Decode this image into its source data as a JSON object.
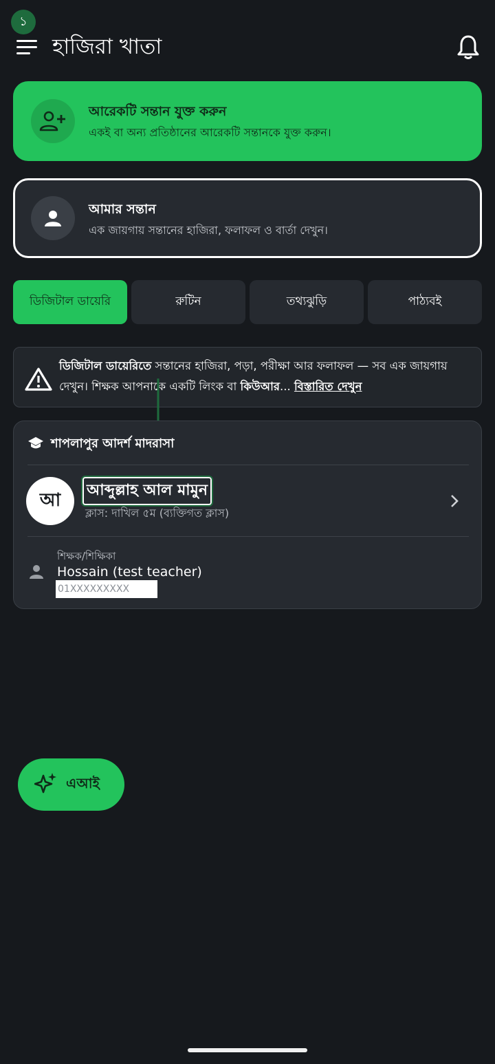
{
  "status": {
    "step_badge": "১"
  },
  "header": {
    "title": "হাজিরা খাতা",
    "menu_icon": "hamburger-icon",
    "notification_icon": "bell-icon"
  },
  "add_child_card": {
    "title": "আরেকটি সন্তান যুক্ত করুন",
    "subtitle": "একই বা অন্য প্রতিষ্ঠানের আরেকটি সন্তানকে যুক্ত করুন।",
    "icon": "add-person-icon"
  },
  "my_child_card": {
    "title": "আমার সন্তান",
    "subtitle": "এক জায়গায় সন্তানের হাজিরা, ফলাফল ও বার্তা দেখুন।",
    "icon": "person-icon"
  },
  "tabs": [
    {
      "label": "ডিজিটাল ডায়েরি",
      "active": true
    },
    {
      "label": "রুটিন",
      "active": false
    },
    {
      "label": "তথ্যঝুড়ি",
      "active": false
    },
    {
      "label": "পাঠ্যবই",
      "active": false
    }
  ],
  "notice": {
    "bold_lead": "ডিজিটাল ডায়েরিতে",
    "text_1": " সন্তানের হাজিরা, পড়া, পরীক্ষা আর ফলাফল — সব এক জায়গায় দেখুন। শিক্ষক আপনাকে একটি লিংক বা ",
    "bold_qr": "কিউআর",
    "ellipsis": "... ",
    "link": "বিস্তারিত দেখুন"
  },
  "institution": {
    "name": "শাপলাপুর আদর্শ মাদরাসা",
    "student": {
      "avatar_initial": "আ",
      "name": "আব্দুল্লাহ আল মামুন",
      "class_info": "ক্লাস: দাখিল ৫ম  (ব্যক্তিগত ক্লাস)"
    },
    "teacher": {
      "label": "শিক্ষক/শিক্ষিকা",
      "name": "Hossain (test teacher)",
      "phone": "01XXXXXXXXX"
    }
  },
  "fab": {
    "label": "এআই",
    "icon": "sparkle-icon"
  },
  "colors": {
    "accent": "#23c35c",
    "background": "#16191d",
    "card": "#262a30"
  }
}
